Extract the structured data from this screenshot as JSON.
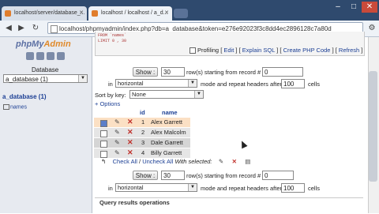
{
  "browser": {
    "tabs": [
      {
        "label": "localhost/server/database_..."
      },
      {
        "label": "localhost / localhost / a_d..."
      }
    ],
    "url": "localhost/phpmyadmin/index.php?db=a_database&token=e276e92023f3c8dd4ec2896128c7a80d"
  },
  "sidebar": {
    "logo_php": "php",
    "logo_my": "My",
    "logo_admin": "Admin",
    "database_label": "Database",
    "database_selected": "a_database (1)",
    "db_link": "a_database (1)",
    "table_link": "names"
  },
  "sql": {
    "line1": "FROM `names`",
    "line2": "LIMIT 0 , 30",
    "profiling": "Profiling",
    "edit": "Edit",
    "explain": "Explain SQL",
    "create_php": "Create PHP Code",
    "refresh": "Refresh"
  },
  "nav_top": {
    "show_button": "Show :",
    "rows_value": "30",
    "rows_label": "row(s) starting from record #",
    "start_value": "0",
    "in_label": "in",
    "mode_value": "horizontal",
    "mode_label": "mode and repeat headers after",
    "headers_value": "100",
    "cells_label": "cells"
  },
  "sort": {
    "label": "Sort by key:",
    "value": "None"
  },
  "options_link": "+ Options",
  "table": {
    "headers": [
      "id",
      "name"
    ],
    "rows": [
      {
        "id": "1",
        "name": "Alex Garrett",
        "checked": true
      },
      {
        "id": "2",
        "name": "Alex Malcolm",
        "checked": false
      },
      {
        "id": "3",
        "name": "Dale Garrett",
        "checked": false
      },
      {
        "id": "4",
        "name": "Billy Garrett",
        "checked": false
      }
    ],
    "row_colors": [
      "#fbe0c4",
      "#e5e5e5",
      "#d5d5d5",
      "#e5e5e5"
    ]
  },
  "with_selected": {
    "check_all": "Check All",
    "separator": "/",
    "uncheck_all": "Uncheck All",
    "label": "With selected:"
  },
  "nav_bottom": {
    "show_button": "Show :",
    "rows_value": "30",
    "rows_label": "row(s) starting from record #",
    "start_value": "0",
    "in_label": "in",
    "mode_value": "horizontal",
    "mode_label": "mode and repeat headers after",
    "headers_value": "100",
    "cells_label": "cells"
  },
  "query_results": {
    "label": "Query results operations"
  }
}
